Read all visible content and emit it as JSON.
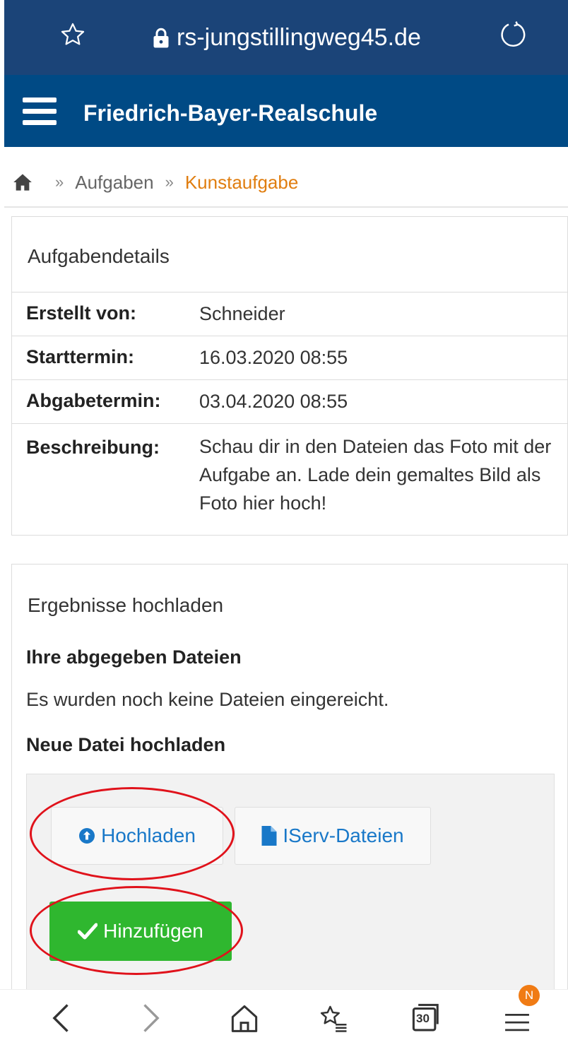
{
  "browser": {
    "url": "rs-jungstillingweg45.de"
  },
  "header": {
    "title": "Friedrich-Bayer-Realschule"
  },
  "breadcrumb": {
    "items": [
      "Aufgaben",
      "Kunstaufgabe"
    ],
    "separator": "»"
  },
  "details": {
    "heading": "Aufgabendetails",
    "rows": [
      {
        "label": "Erstellt von:",
        "value": "Schneider"
      },
      {
        "label": "Starttermin:",
        "value": "16.03.2020 08:55"
      },
      {
        "label": "Abgabetermin:",
        "value": "03.04.2020 08:55"
      },
      {
        "label": "Beschreibung:",
        "value": "Schau dir in den Dateien das Foto mit der Aufgabe an. Lade dein gemaltes Bild als Foto hier hoch!"
      }
    ]
  },
  "upload": {
    "heading": "Ergebnisse hochladen",
    "submitted_title": "Ihre abgegeben Dateien",
    "submitted_note": "Es wurden noch keine Dateien eingereicht.",
    "new_title": "Neue Datei hochladen",
    "upload_button": "Hochladen",
    "iserv_button": "IServ-Dateien",
    "add_button": "Hinzufügen"
  },
  "bottom_nav": {
    "tabs_count": "30",
    "badge": "N"
  },
  "colors": {
    "urlbar": "#1b4478",
    "appbar": "#004a85",
    "breadcrumb_active": "#e07e10",
    "link_blue": "#1978c8",
    "add_green": "#2fb72f",
    "annotation_red": "#e0121b"
  }
}
